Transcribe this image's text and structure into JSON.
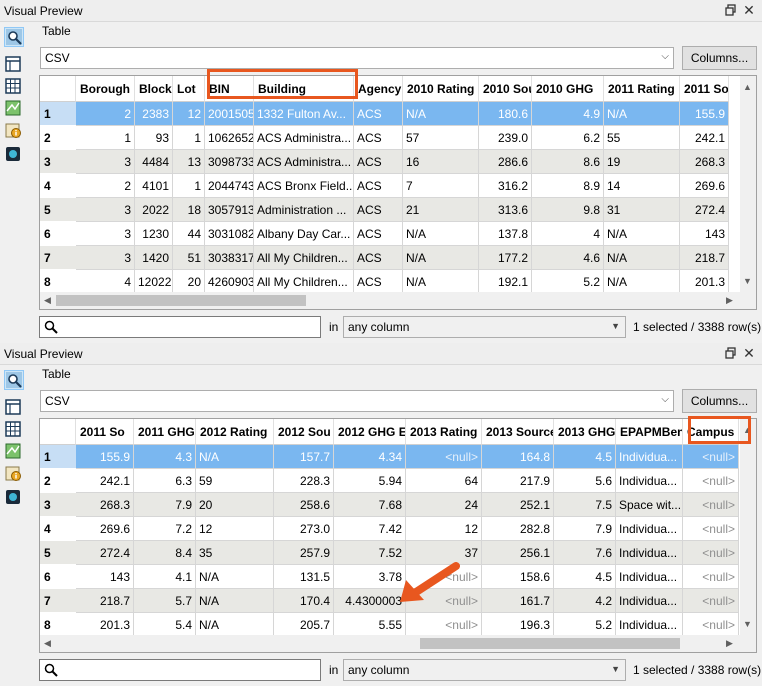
{
  "panel_title": "Visual Preview",
  "table_label": "Table",
  "format": "CSV",
  "columns_button": "Columns...",
  "search": {
    "placeholder": "",
    "in_label": "in",
    "column": "any column"
  },
  "status_text": "1 selected / 3388 row(s)",
  "colors": {
    "selected": "#7ab7f0",
    "alt_row": "#e8e8e4",
    "highlight": "#e8571f"
  },
  "tools": [
    "inspect-icon",
    "table-view-icon",
    "grid-icon",
    "map-icon",
    "info-icon",
    "viewer-3d-icon"
  ],
  "top_table": {
    "columns": [
      "Borough",
      "Block",
      "Lot",
      "BIN",
      "Building",
      "Agency",
      "2010 Rating",
      "2010 Sou",
      "2010 GHG",
      "2011 Rating",
      "2011 So"
    ],
    "rows": [
      {
        "n": "1",
        "c": [
          "2",
          "2383",
          "12",
          "2001505",
          "1332 Fulton Av...",
          "ACS",
          "N/A",
          "180.6",
          "4.9",
          "N/A",
          "155.9"
        ]
      },
      {
        "n": "2",
        "c": [
          "1",
          "93",
          "1",
          "1062652",
          "ACS Administra...",
          "ACS",
          "57",
          "239.0",
          "6.2",
          "55",
          "242.1"
        ]
      },
      {
        "n": "3",
        "c": [
          "3",
          "4484",
          "13",
          "3098733",
          "ACS Administra...",
          "ACS",
          "16",
          "286.6",
          "8.6",
          "19",
          "268.3"
        ]
      },
      {
        "n": "4",
        "c": [
          "2",
          "4101",
          "1",
          "2044743",
          "ACS Bronx Field...",
          "ACS",
          "7",
          "316.2",
          "8.9",
          "14",
          "269.6"
        ]
      },
      {
        "n": "5",
        "c": [
          "3",
          "2022",
          "18",
          "3057913",
          "Administration ...",
          "ACS",
          "21",
          "313.6",
          "9.8",
          "31",
          "272.4"
        ]
      },
      {
        "n": "6",
        "c": [
          "3",
          "1230",
          "44",
          "3031082",
          "Albany Day Car...",
          "ACS",
          "N/A",
          "137.8",
          "4",
          "N/A",
          "143"
        ]
      },
      {
        "n": "7",
        "c": [
          "3",
          "1420",
          "51",
          "3038317",
          "All My Children...",
          "ACS",
          "N/A",
          "177.2",
          "4.6",
          "N/A",
          "218.7"
        ]
      },
      {
        "n": "8",
        "c": [
          "4",
          "12022",
          "20",
          "4260903",
          "All My Children...",
          "ACS",
          "N/A",
          "192.1",
          "5.2",
          "N/A",
          "201.3"
        ]
      }
    ]
  },
  "bottom_table": {
    "columns": [
      "2011 So",
      "2011 GHG",
      "2012 Rating",
      "2012 Sou",
      "2012 GHG E",
      "2013 Rating",
      "2013 Source",
      "2013 GHG",
      "EPAPMBen",
      "Campus"
    ],
    "rows": [
      {
        "n": "1",
        "c": [
          "155.9",
          "4.3",
          "N/A",
          "157.7",
          "4.34",
          "<null>",
          "164.8",
          "4.5",
          "Individua...",
          "<null>"
        ]
      },
      {
        "n": "2",
        "c": [
          "242.1",
          "6.3",
          "59",
          "228.3",
          "5.94",
          "64",
          "217.9",
          "5.6",
          "Individua...",
          "<null>"
        ]
      },
      {
        "n": "3",
        "c": [
          "268.3",
          "7.9",
          "20",
          "258.6",
          "7.68",
          "24",
          "252.1",
          "7.5",
          "Space wit...",
          "<null>"
        ]
      },
      {
        "n": "4",
        "c": [
          "269.6",
          "7.2",
          "12",
          "273.0",
          "7.42",
          "12",
          "282.8",
          "7.9",
          "Individua...",
          "<null>"
        ]
      },
      {
        "n": "5",
        "c": [
          "272.4",
          "8.4",
          "35",
          "257.9",
          "7.52",
          "37",
          "256.1",
          "7.6",
          "Individua...",
          "<null>"
        ]
      },
      {
        "n": "6",
        "c": [
          "143",
          "4.1",
          "N/A",
          "131.5",
          "3.78",
          "<null>",
          "158.6",
          "4.5",
          "Individua...",
          "<null>"
        ]
      },
      {
        "n": "7",
        "c": [
          "218.7",
          "5.7",
          "N/A",
          "170.4",
          "4.4300003",
          "<null>",
          "161.7",
          "4.2",
          "Individua...",
          "<null>"
        ]
      },
      {
        "n": "8",
        "c": [
          "201.3",
          "5.4",
          "N/A",
          "205.7",
          "5.55",
          "<null>",
          "196.3",
          "5.2",
          "Individua...",
          "<null>"
        ]
      }
    ]
  }
}
